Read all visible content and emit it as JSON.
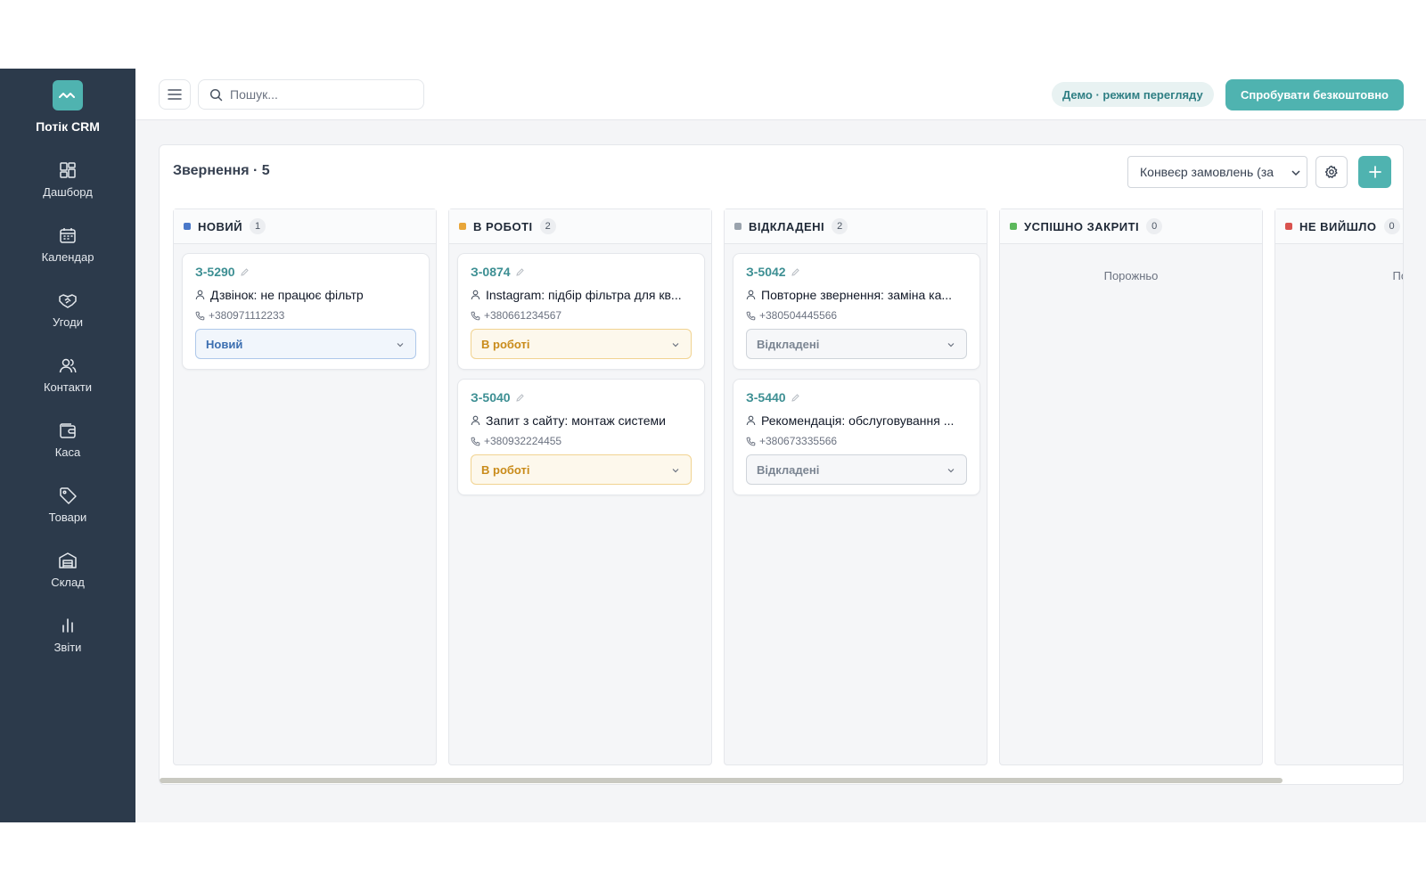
{
  "app": {
    "brand": "Потік CRM",
    "accent_color": "#4fb3b0",
    "sidebar_color": "#2c3a4b"
  },
  "sidebar": {
    "items": [
      {
        "label": "Дашборд",
        "icon": "dashboard-icon"
      },
      {
        "label": "Календар",
        "icon": "calendar-icon"
      },
      {
        "label": "Угоди",
        "icon": "handshake-icon"
      },
      {
        "label": "Контакти",
        "icon": "users-icon"
      },
      {
        "label": "Каса",
        "icon": "wallet-icon"
      },
      {
        "label": "Товари",
        "icon": "tag-icon"
      },
      {
        "label": "Склад",
        "icon": "warehouse-icon"
      },
      {
        "label": "Звіти",
        "icon": "bar-chart-icon"
      }
    ]
  },
  "topbar": {
    "search_placeholder": "Пошук...",
    "demo_badge": "Демо · режим перегляду",
    "try_button": "Спробувати безкоштовно"
  },
  "board": {
    "title": "Звернення · 5",
    "pipeline_value": "Конвеєр замовлень (за",
    "columns": [
      {
        "title": "НОВИЙ",
        "count": "1",
        "color": "#4a78c9",
        "cards": [
          {
            "id": "З-5290",
            "title": "Дзвінок: не працює фільтр",
            "phone": "+380971112233",
            "status": "Новий"
          }
        ]
      },
      {
        "title": "В РОБОТІ",
        "count": "2",
        "color": "#e8a63a",
        "cards": [
          {
            "id": "З-0874",
            "title": "Instagram: підбір фільтра для кв...",
            "phone": "+380661234567",
            "status": "В роботі"
          },
          {
            "id": "З-5040",
            "title": "Запит з сайту: монтаж системи",
            "phone": "+380932224455",
            "status": "В роботі"
          }
        ]
      },
      {
        "title": "ВІДКЛАДЕНІ",
        "count": "2",
        "color": "#9aa3ad",
        "cards": [
          {
            "id": "З-5042",
            "title": "Повторне звернення: заміна ка...",
            "phone": "+380504445566",
            "status": "Відкладені"
          },
          {
            "id": "З-5440",
            "title": "Рекомендація: обслуговування ...",
            "phone": "+380673335566",
            "status": "Відкладені"
          }
        ]
      },
      {
        "title": "УСПІШНО ЗАКРИТІ",
        "count": "0",
        "color": "#5cb85c",
        "empty_label": "Порожньо"
      },
      {
        "title": "НЕ ВИЙШЛО",
        "count": "0",
        "color": "#d9534f",
        "empty_label": "Поро"
      }
    ]
  }
}
